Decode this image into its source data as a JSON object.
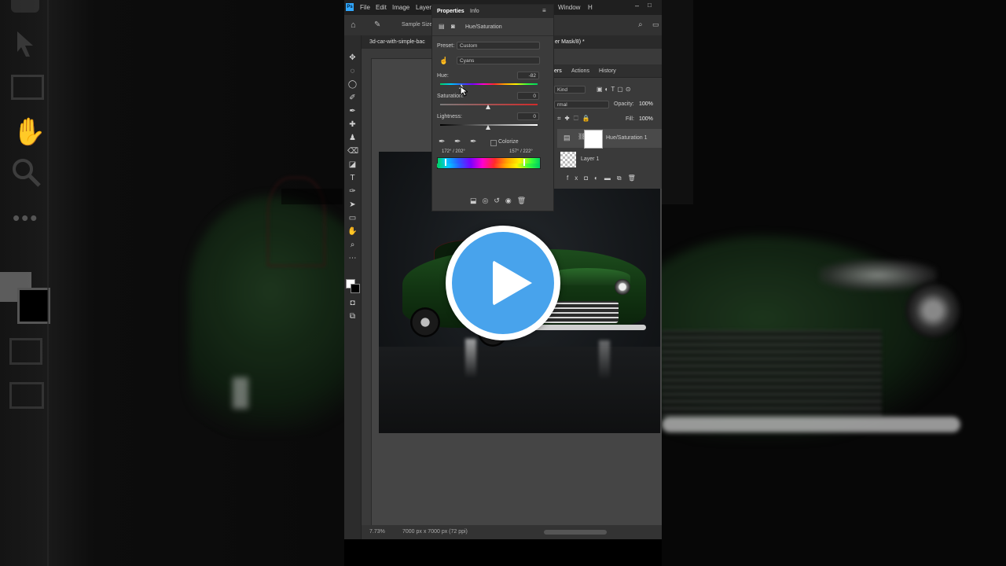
{
  "menubar": {
    "items": [
      "File",
      "Edit",
      "Image",
      "Layer",
      "Window",
      "H"
    ],
    "app_badge": "Ps"
  },
  "options_bar": {
    "sample_label": "Sample Size"
  },
  "document": {
    "tab_title": "3d-car-with-simple-bac",
    "tab_title_suffix": "er Mask/8) *",
    "zoom": "7.73%",
    "dimensions": "7000 px x 7000 px (72 ppi)"
  },
  "properties": {
    "tabs": [
      "Properties",
      "Info"
    ],
    "panel_title": "Hue/Saturation",
    "preset_label": "Preset:",
    "preset_value": "Custom",
    "channel_value": "Cyans",
    "hue_label": "Hue:",
    "hue_value": "-82",
    "hue": -82,
    "saturation_label": "Saturation:",
    "saturation_value": "0",
    "saturation": 0,
    "lightness_label": "Lightness:",
    "lightness_value": "0",
    "lightness": 0,
    "colorize_label": "Colorize",
    "range_left": "172° / 202°",
    "range_right": "157° / 222°"
  },
  "layers": {
    "tabs": [
      "ers",
      "Actions",
      "History"
    ],
    "filter_label": "Kind",
    "blend_mode": "rmal",
    "opacity_label": "Opacity:",
    "opacity_value": "100%",
    "fill_label": "Fill:",
    "fill_value": "100%",
    "items": [
      {
        "name": "Hue/Saturation 1"
      },
      {
        "name": "Layer 1"
      }
    ]
  },
  "colors": {
    "accent_play": "#48a3ec",
    "car_green": "#1d4d1d",
    "panel_bg": "#3b3b3b"
  }
}
